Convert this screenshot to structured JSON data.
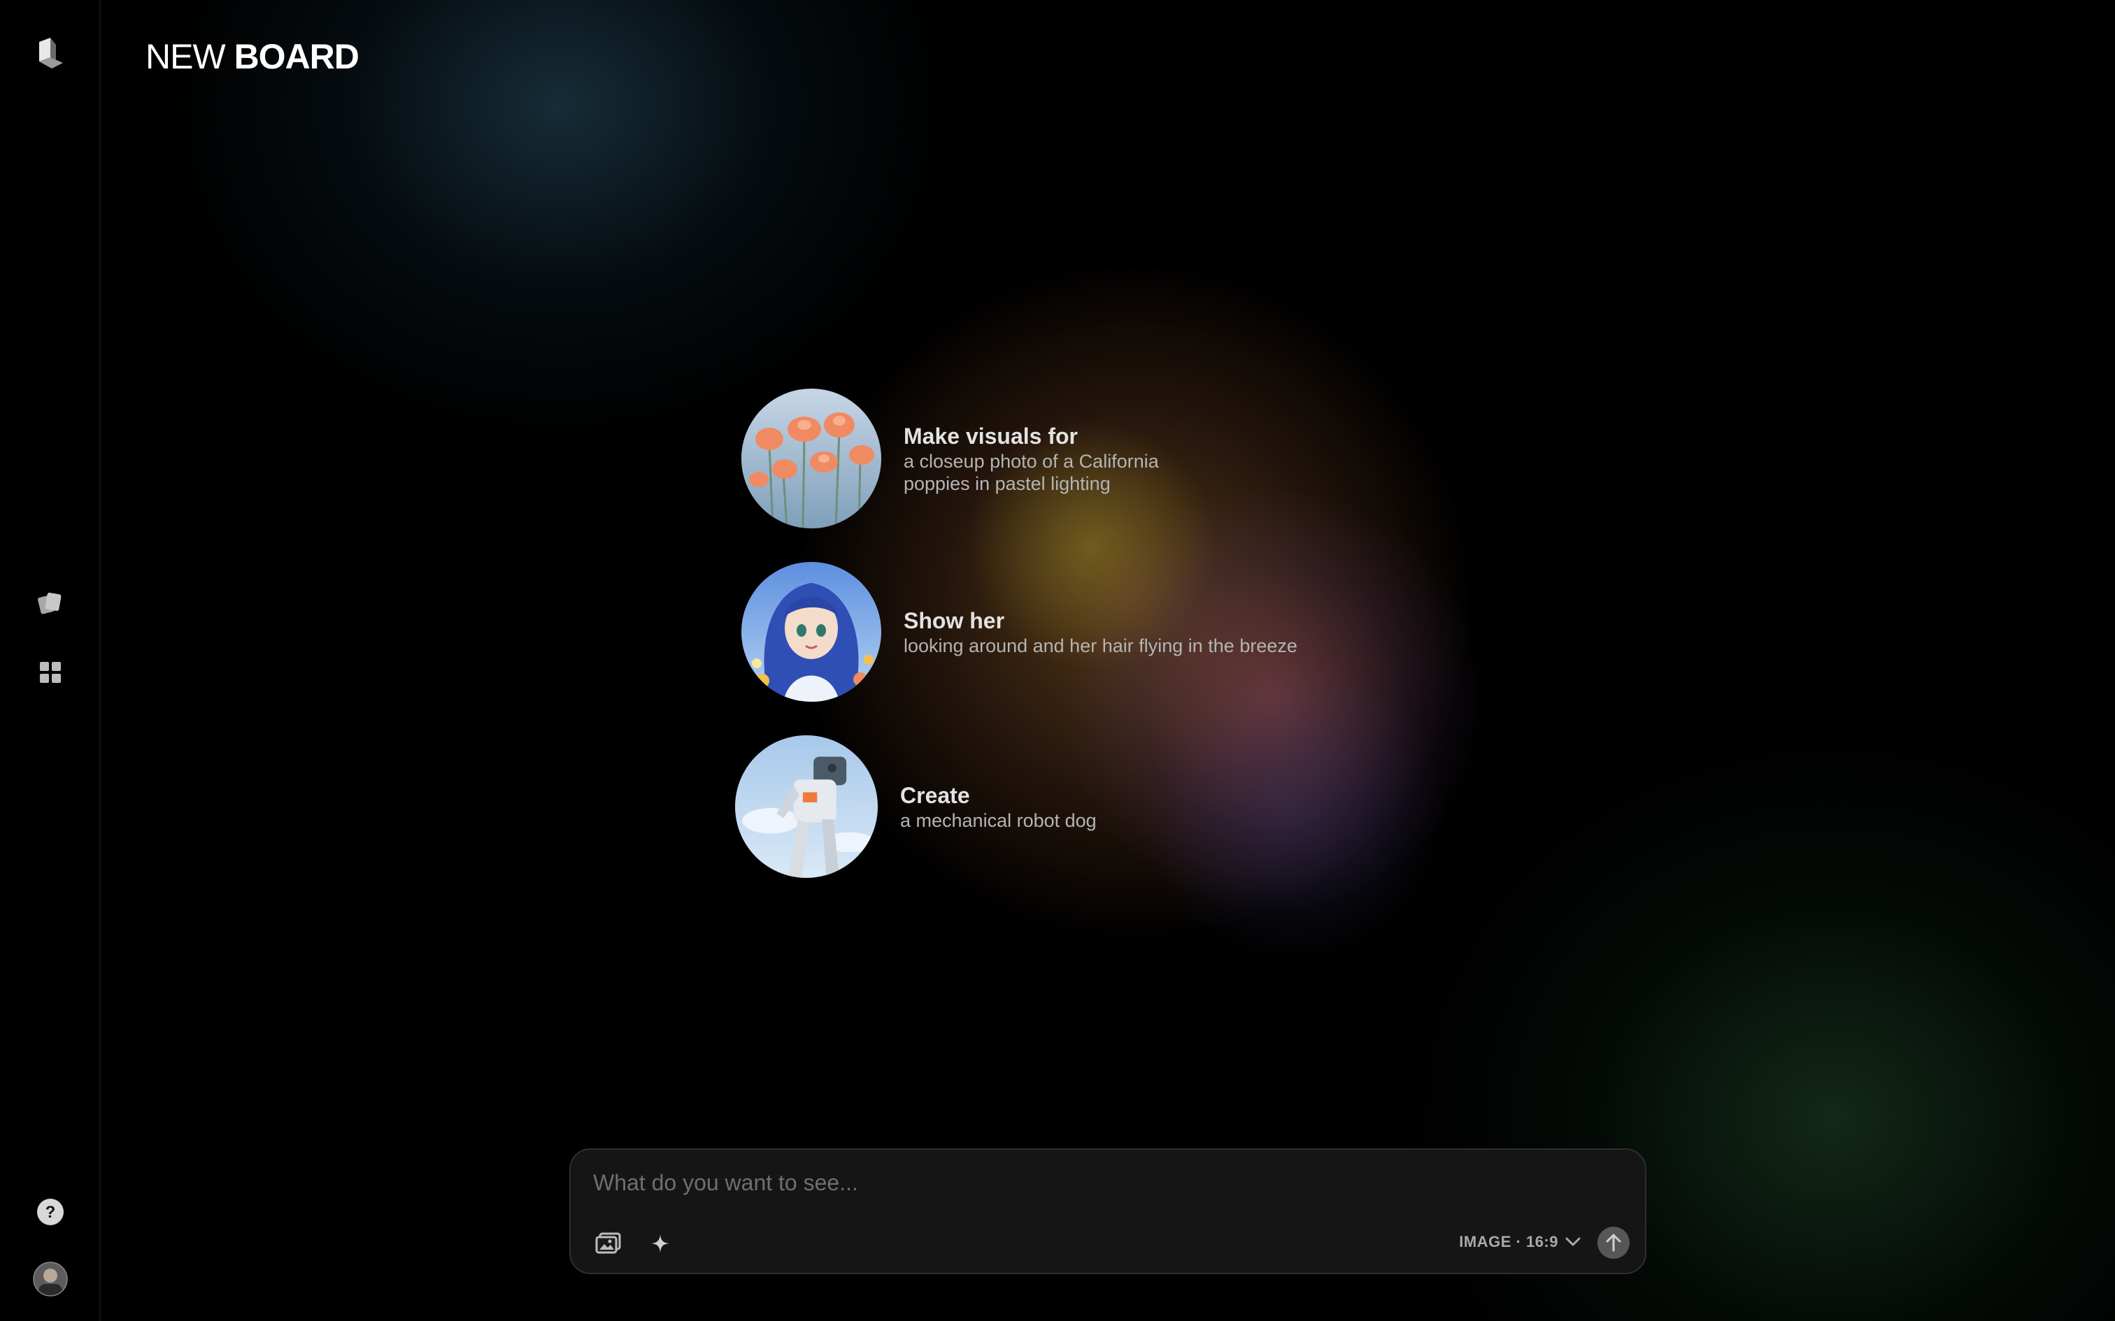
{
  "app": {
    "title_light": "NEW",
    "title_bold": "BOARD"
  },
  "sidebar": {
    "items": [
      {
        "name": "logo",
        "icon": "logo-icon"
      },
      {
        "name": "cards",
        "icon": "cards-icon"
      },
      {
        "name": "grid",
        "icon": "grid-icon"
      },
      {
        "name": "help",
        "icon": "help-icon"
      },
      {
        "name": "profile",
        "icon": "avatar"
      }
    ]
  },
  "suggestions": [
    {
      "title": "Make visuals for",
      "subtitle_lines": [
        "a closeup photo of a California",
        "poppies in pastel lighting"
      ],
      "thumbnail": "poppies-thumbnail"
    },
    {
      "title": "Show her",
      "subtitle_lines": [
        "looking around and her hair flying in the breeze"
      ],
      "thumbnail": "anime-girl-thumbnail"
    },
    {
      "title": "Create",
      "subtitle_lines": [
        "a mechanical robot dog"
      ],
      "thumbnail": "robot-thumbnail"
    }
  ],
  "prompt": {
    "placeholder": "What do you want to see...",
    "mode_label": "IMAGE · 16:9",
    "icons": [
      "image-upload-icon",
      "sparkle-icon",
      "chevron-down-icon",
      "send-arrow-icon"
    ]
  },
  "colors": {
    "background": "#000000",
    "text": "#ffffff",
    "muted": "#b4b4b4"
  }
}
